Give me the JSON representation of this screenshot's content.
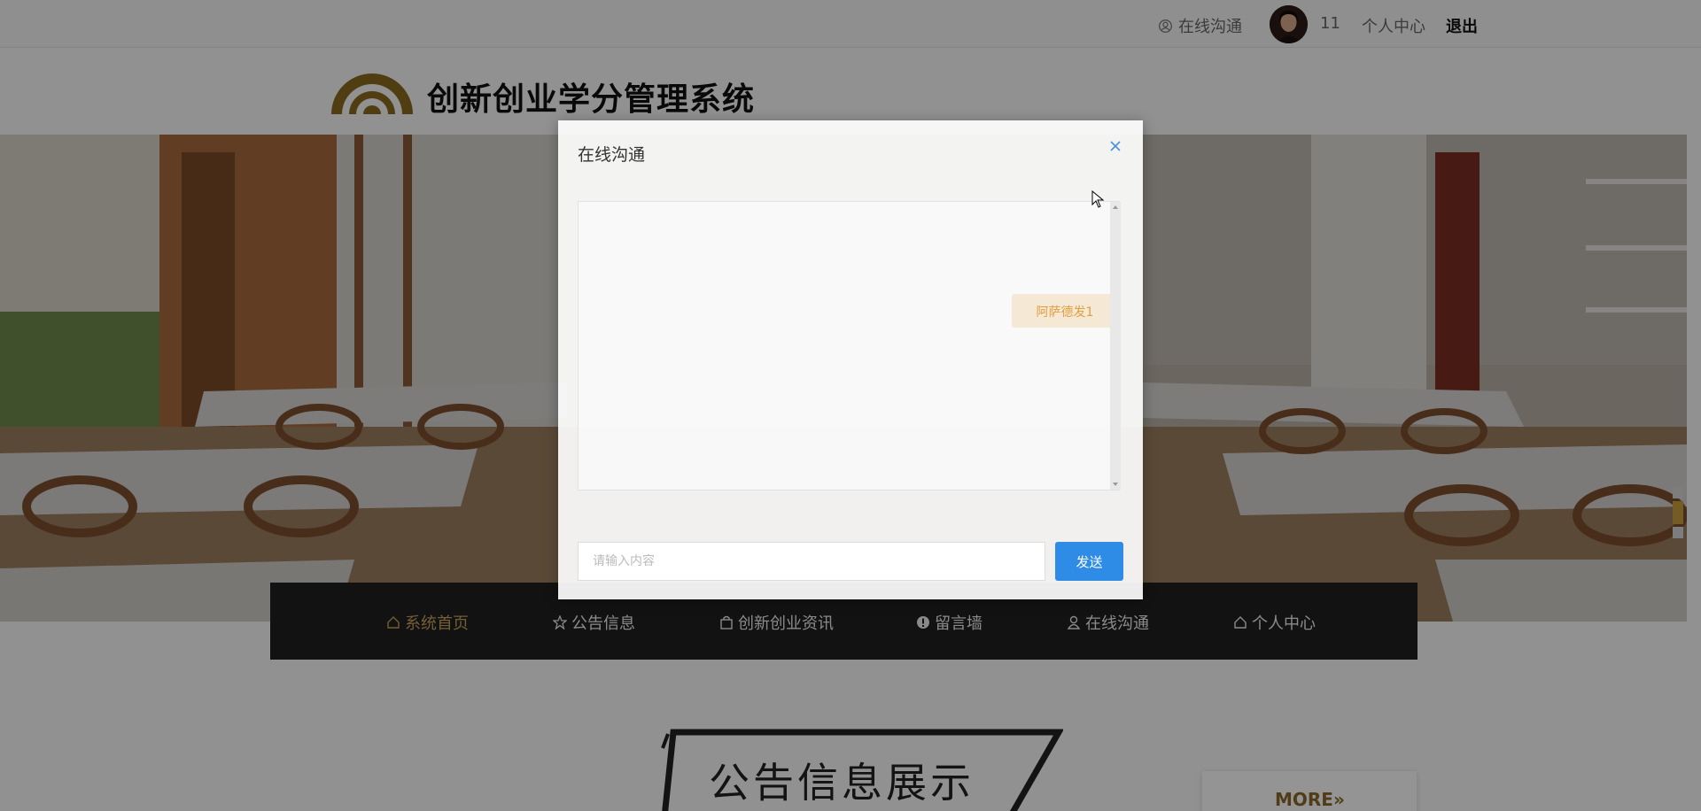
{
  "topbar": {
    "chat_label": "在线沟通",
    "username": "11",
    "center_label": "个人中心",
    "logout_label": "退出"
  },
  "header": {
    "site_title": "创新创业学分管理系统"
  },
  "nav": {
    "items": [
      {
        "label": "系统首页",
        "icon": "home-icon",
        "active": true
      },
      {
        "label": "公告信息",
        "icon": "star-icon"
      },
      {
        "label": "创新创业资讯",
        "icon": "bag-icon"
      },
      {
        "label": "留言墙",
        "icon": "alert-icon"
      },
      {
        "label": "在线沟通",
        "icon": "user-icon"
      },
      {
        "label": "个人中心",
        "icon": "home-icon"
      }
    ]
  },
  "section": {
    "title": "公告信息展示",
    "more_label": "MORE"
  },
  "modal": {
    "title": "在线沟通",
    "messages": [
      {
        "text": "阿萨德发1",
        "side": "right"
      }
    ],
    "input_placeholder": "请输入内容",
    "send_label": "发送"
  },
  "colors": {
    "accent_gold": "#c9a35a",
    "send_blue": "#2e8be6",
    "nav_bg": "#1f1f1f"
  }
}
